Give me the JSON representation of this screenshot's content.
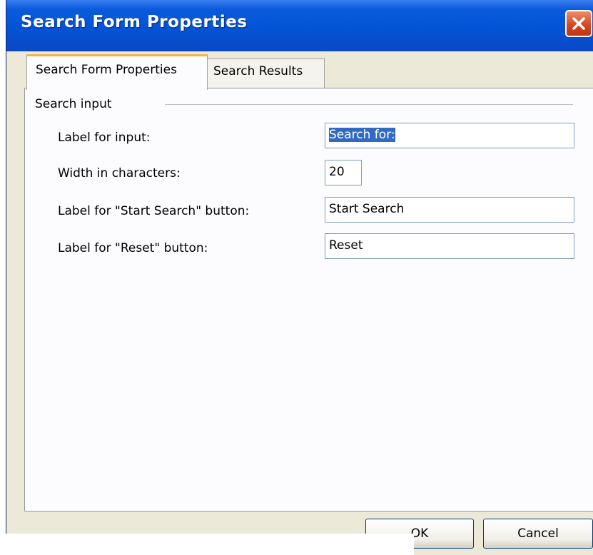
{
  "window": {
    "title": "Search Form Properties"
  },
  "tabs": [
    {
      "label": "Search Form Properties",
      "active": true
    },
    {
      "label": "Search Results",
      "active": false
    }
  ],
  "group": {
    "label": "Search input"
  },
  "fields": [
    {
      "label": "Label for input:",
      "value": "Search for:",
      "selected": true
    },
    {
      "label": "Width in characters:",
      "value": "20"
    },
    {
      "label": "Label for \"Start Search\" button:",
      "value": "Start Search"
    },
    {
      "label": "Label for \"Reset\" button:",
      "value": "Reset"
    }
  ],
  "buttons": {
    "ok": "OK",
    "cancel": "Cancel"
  },
  "colors": {
    "titlebar": "#0453d6",
    "selection": "#316ac5",
    "dialog_bg": "#ece9d8",
    "close": "#d4441e"
  }
}
